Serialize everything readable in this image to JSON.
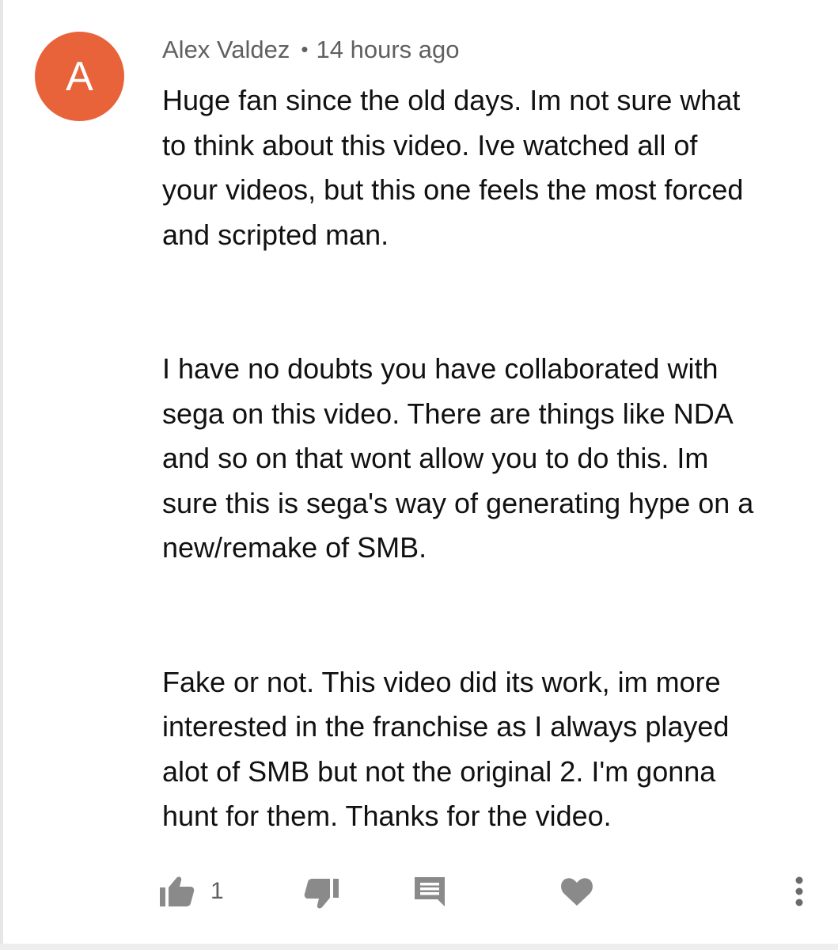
{
  "comment": {
    "avatar_letter": "A",
    "author": "Alex Valdez",
    "separator": "•",
    "timestamp": "14 hours ago",
    "paragraphs": [
      "Huge fan since the old days. Im not sure what\nto think about this video. Ive watched all of\nyour videos, but this one feels the most forced\nand scripted man.",
      "I have no doubts you have collaborated with\nsega on this video. There are things like NDA\nand so on that wont allow you to do this. Im\nsure this is sega's way of generating hype on a\nnew/remake of SMB.",
      "Fake or not. This video did its work, im more\ninterested in the franchise as I always played\nalot of SMB but not the original 2. I'm gonna\nhunt for them. Thanks for the video."
    ],
    "like_count": "1"
  },
  "colors": {
    "avatar_bg": "#e8623a",
    "meta_text": "#606060",
    "icon": "#8a8a8a"
  },
  "icons": {
    "like": "thumbs-up-icon",
    "dislike": "thumbs-down-icon",
    "reply": "reply-comment-icon",
    "heart": "heart-icon",
    "more": "more-vertical-icon"
  }
}
